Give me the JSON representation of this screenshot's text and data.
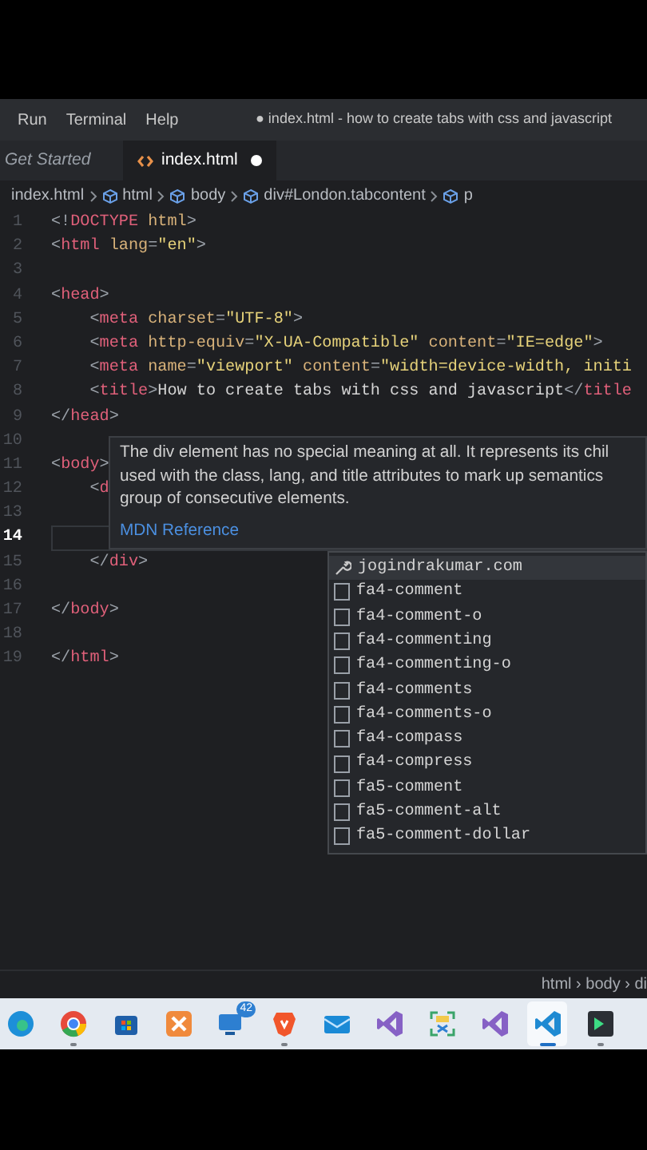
{
  "menu": [
    "Run",
    "Terminal",
    "Help"
  ],
  "window_title": "● index.html - how to create tabs with css and javascript",
  "tabs": [
    {
      "label": "Get Started",
      "kind": "welcome",
      "selected": false,
      "modified": false
    },
    {
      "label": "index.html",
      "kind": "html",
      "selected": true,
      "modified": true
    }
  ],
  "breadcrumb": [
    {
      "label": "index.html",
      "kind": "file"
    },
    {
      "label": "html",
      "kind": "element"
    },
    {
      "label": "body",
      "kind": "element"
    },
    {
      "label": "div#London.tabcontent",
      "kind": "element"
    },
    {
      "label": "p",
      "kind": "element"
    }
  ],
  "code_lines": [
    {
      "number": "1",
      "current": false,
      "segments": [
        {
          "kind": "punct",
          "text": "<!"
        },
        {
          "kind": "tag",
          "text": "DOCTYPE"
        },
        {
          "kind": "attr",
          "text": " html"
        },
        {
          "kind": "punct",
          "text": ">"
        }
      ]
    },
    {
      "number": "2",
      "current": false,
      "segments": [
        {
          "kind": "punct",
          "text": "<"
        },
        {
          "kind": "tag",
          "text": "html"
        },
        {
          "kind": "attr",
          "text": " lang"
        },
        {
          "kind": "punct",
          "text": "="
        },
        {
          "kind": "str",
          "text": "\"en\""
        },
        {
          "kind": "punct",
          "text": ">"
        }
      ]
    },
    {
      "number": "3",
      "current": false
    },
    {
      "number": "4",
      "current": false,
      "segments": [
        {
          "kind": "punct",
          "text": "<"
        },
        {
          "kind": "tag",
          "text": "head"
        },
        {
          "kind": "punct",
          "text": ">"
        }
      ]
    },
    {
      "number": "5",
      "current": false,
      "segments": [
        {
          "kind": "punct",
          "text": "    <"
        },
        {
          "kind": "tag",
          "text": "meta"
        },
        {
          "kind": "attr",
          "text": " charset"
        },
        {
          "kind": "punct",
          "text": "="
        },
        {
          "kind": "str",
          "text": "\"UTF-8\""
        },
        {
          "kind": "punct",
          "text": ">"
        }
      ]
    },
    {
      "number": "6",
      "current": false,
      "segments": [
        {
          "kind": "punct",
          "text": "    <"
        },
        {
          "kind": "tag",
          "text": "meta"
        },
        {
          "kind": "attr",
          "text": " http-equiv"
        },
        {
          "kind": "punct",
          "text": "="
        },
        {
          "kind": "str",
          "text": "\"X-UA-Compatible\""
        },
        {
          "kind": "attr",
          "text": " content"
        },
        {
          "kind": "punct",
          "text": "="
        },
        {
          "kind": "str",
          "text": "\"IE=edge\""
        },
        {
          "kind": "punct",
          "text": ">"
        }
      ]
    },
    {
      "number": "7",
      "current": false,
      "segments": [
        {
          "kind": "punct",
          "text": "    <"
        },
        {
          "kind": "tag",
          "text": "meta"
        },
        {
          "kind": "attr",
          "text": " name"
        },
        {
          "kind": "punct",
          "text": "="
        },
        {
          "kind": "str",
          "text": "\"viewport\""
        },
        {
          "kind": "attr",
          "text": " content"
        },
        {
          "kind": "punct",
          "text": "="
        },
        {
          "kind": "str",
          "text": "\"width=device-width, initi"
        }
      ]
    },
    {
      "number": "8",
      "current": false,
      "segments": [
        {
          "kind": "punct",
          "text": "    <"
        },
        {
          "kind": "tag",
          "text": "title"
        },
        {
          "kind": "punct",
          "text": ">"
        },
        {
          "kind": "text",
          "text": "How to create tabs with css and javascript"
        },
        {
          "kind": "punct",
          "text": "</"
        },
        {
          "kind": "tag",
          "text": "title"
        }
      ]
    },
    {
      "number": "9",
      "current": false,
      "segments": [
        {
          "kind": "punct",
          "text": "</"
        },
        {
          "kind": "tag",
          "text": "head"
        },
        {
          "kind": "punct",
          "text": ">"
        }
      ]
    },
    {
      "number": "10",
      "current": false
    },
    {
      "number": "11",
      "current": false,
      "segments": [
        {
          "kind": "punct",
          "text": "<"
        },
        {
          "kind": "tag",
          "text": "body"
        },
        {
          "kind": "punct",
          "text": ">"
        }
      ]
    },
    {
      "number": "12",
      "current": false,
      "segments": [
        {
          "kind": "punct",
          "text": "    <"
        },
        {
          "kind": "tag",
          "text": "d"
        }
      ]
    },
    {
      "number": "13",
      "current": false
    },
    {
      "number": "14",
      "current": true
    },
    {
      "number": "15",
      "current": false,
      "segments": [
        {
          "kind": "punct",
          "text": "    </"
        },
        {
          "kind": "tag",
          "text": "div"
        },
        {
          "kind": "punct",
          "text": ">"
        }
      ]
    },
    {
      "number": "16",
      "current": false
    },
    {
      "number": "17",
      "current": false,
      "segments": [
        {
          "kind": "punct",
          "text": "</"
        },
        {
          "kind": "tag",
          "text": "body"
        },
        {
          "kind": "punct",
          "text": ">"
        }
      ]
    },
    {
      "number": "18",
      "current": false
    },
    {
      "number": "19",
      "current": false,
      "segments": [
        {
          "kind": "punct",
          "text": "</"
        },
        {
          "kind": "tag",
          "text": "html"
        },
        {
          "kind": "punct",
          "text": ">"
        }
      ]
    }
  ],
  "hover_tooltip": {
    "lines": [
      "The div element has no special meaning at all. It represents its chil",
      "used with the class, lang, and title attributes to mark up semantics",
      "group of consecutive elements."
    ],
    "link": "MDN Reference"
  },
  "suggestions": [
    {
      "label": "jogindrakumar.com",
      "kind": "snippet",
      "selected": true
    },
    {
      "label": "fa4-comment",
      "kind": "text",
      "selected": false
    },
    {
      "label": "fa4-comment-o",
      "kind": "text",
      "selected": false
    },
    {
      "label": "fa4-commenting",
      "kind": "text",
      "selected": false
    },
    {
      "label": "fa4-commenting-o",
      "kind": "text",
      "selected": false
    },
    {
      "label": "fa4-comments",
      "kind": "text",
      "selected": false
    },
    {
      "label": "fa4-comments-o",
      "kind": "text",
      "selected": false
    },
    {
      "label": "fa4-compass",
      "kind": "text",
      "selected": false
    },
    {
      "label": "fa4-compress",
      "kind": "text",
      "selected": false
    },
    {
      "label": "fa5-comment",
      "kind": "text",
      "selected": false
    },
    {
      "label": "fa5-comment-alt",
      "kind": "text",
      "selected": false
    },
    {
      "label": "fa5-comment-dollar",
      "kind": "text",
      "selected": false
    }
  ],
  "status_breadcrumb": "html › body › di",
  "taskbar": [
    {
      "kind": "edge",
      "running": false,
      "selected": false
    },
    {
      "kind": "chrome",
      "running": true,
      "selected": false
    },
    {
      "kind": "store",
      "running": false,
      "selected": false
    },
    {
      "kind": "xampp",
      "running": false,
      "selected": false
    },
    {
      "kind": "monitor",
      "running": false,
      "selected": false,
      "badge": "42"
    },
    {
      "kind": "brave",
      "running": true,
      "selected": false
    },
    {
      "kind": "mail",
      "running": false,
      "selected": false
    },
    {
      "kind": "studio",
      "running": false,
      "selected": false
    },
    {
      "kind": "capture",
      "running": false,
      "selected": false
    },
    {
      "kind": "studio",
      "running": false,
      "selected": false
    },
    {
      "kind": "vscode",
      "running": true,
      "selected": true
    },
    {
      "kind": "terminal",
      "running": true,
      "selected": false
    }
  ]
}
